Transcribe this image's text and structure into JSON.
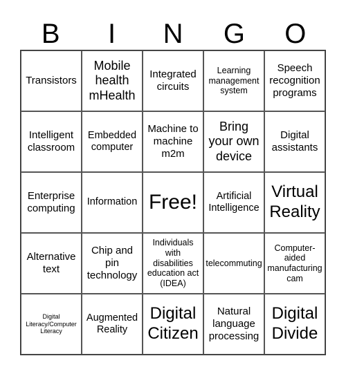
{
  "title_letters": [
    "B",
    "I",
    "N",
    "G",
    "O"
  ],
  "cells": [
    [
      "Transistors",
      "Mobile health mHealth",
      "Integrated circuits",
      "Learning management system",
      "Speech recognition programs"
    ],
    [
      "Intelligent classroom",
      "Embedded computer",
      "Machine to machine m2m",
      "Bring your own device",
      "Digital assistants"
    ],
    [
      "Enterprise computing",
      "Information",
      "Free!",
      "Artificial Intelligence",
      "Virtual Reality"
    ],
    [
      "Alternative text",
      "Chip and pin technology",
      "Individuals with disabilities education act (IDEA)",
      "telecommuting",
      "Computer-aided manufacturing cam"
    ],
    [
      "Digital Literacy/Computer Literacy",
      "Augmented Reality",
      "Digital Citizen",
      "Natural language processing",
      "Digital Divide"
    ]
  ]
}
